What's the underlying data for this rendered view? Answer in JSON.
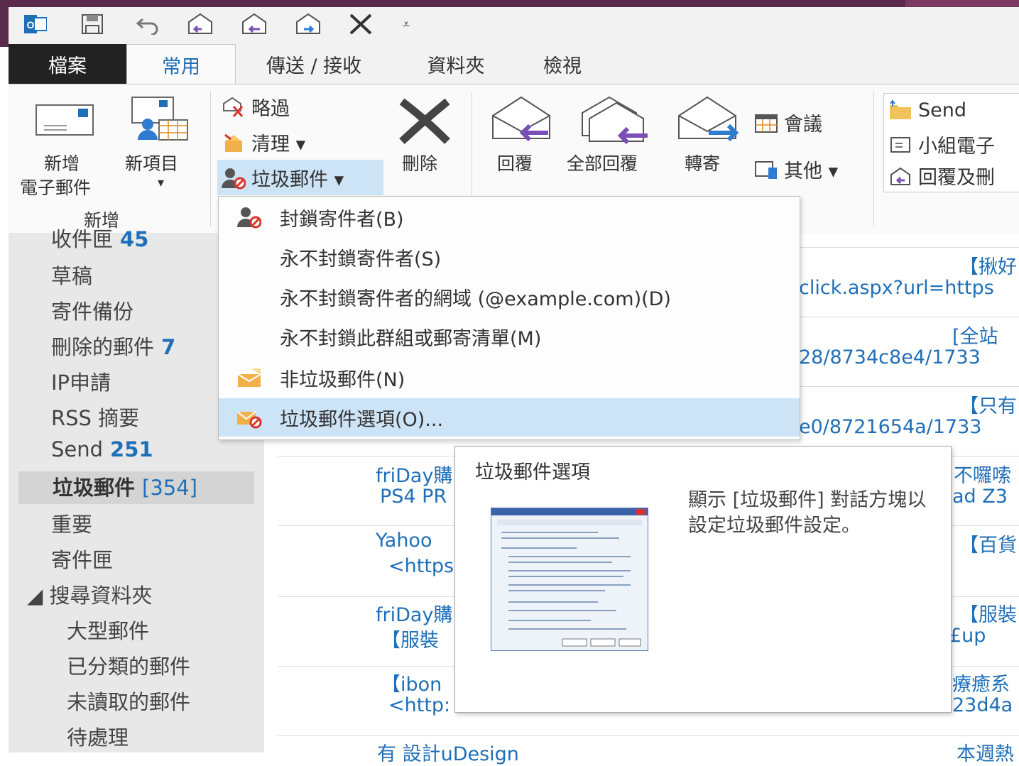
{
  "titlebar": {
    "qat_icons": [
      "outlook-icon",
      "save-icon",
      "undo-icon",
      "reply-icon",
      "reply-all-icon",
      "forward-icon",
      "delete-icon",
      "customize-icon"
    ]
  },
  "tabs": [
    {
      "label": "檔案"
    },
    {
      "label": "常用"
    },
    {
      "label": "傳送 / 接收"
    },
    {
      "label": "資料夾"
    },
    {
      "label": "檢視"
    }
  ],
  "ribbon": {
    "new_email": {
      "line1": "新增",
      "line2": "電子郵件"
    },
    "new_items": {
      "label": "新項目",
      "arrow": "▾"
    },
    "group_new": "新增",
    "ignore": "略過",
    "cleanup": "清理 ▾",
    "junk": "垃圾郵件 ▾",
    "delete": "刪除",
    "reply": "回覆",
    "reply_all": "全部回覆",
    "forward": "轉寄",
    "meeting": "會議",
    "more": "其他 ▾",
    "quicksteps": [
      "Send",
      "小組電子",
      "回覆及刪"
    ]
  },
  "folders": [
    {
      "name": "收件匣",
      "count": "45"
    },
    {
      "name": "草稿",
      "count": ""
    },
    {
      "name": "寄件備份",
      "count": ""
    },
    {
      "name": "刪除的郵件",
      "count": "7"
    },
    {
      "name": "IP申請",
      "count": ""
    },
    {
      "name": "RSS 摘要",
      "count": ""
    },
    {
      "name": "Send",
      "count": "251"
    },
    {
      "name": "垃圾郵件",
      "count": "[354]"
    },
    {
      "name": "重要",
      "count": ""
    },
    {
      "name": "寄件匣",
      "count": ""
    },
    {
      "name": "◢ 搜尋資料夾",
      "count": ""
    },
    {
      "name": "大型郵件",
      "count": ""
    },
    {
      "name": "已分類的郵件",
      "count": ""
    },
    {
      "name": "未讀取的郵件",
      "count": ""
    },
    {
      "name": "待處理",
      "count": ""
    }
  ],
  "messages": {
    "right": [
      "【揪好",
      "click.aspx?url=https",
      "[全站",
      "28/8734c8e4/1733",
      "【只有",
      "e0/8721654a/1733",
      "不囉嗦",
      "ad Z3",
      "【百貨",
      "【服裝",
      "£up",
      "療癒系",
      "23d4a",
      "本週熱"
    ],
    "left": [
      "friDay購",
      "PS4 PR",
      "Yahoo",
      "<https",
      "friDay購",
      "【服裝",
      "【ibon",
      "<http:",
      "有 設計uDesign"
    ]
  },
  "dropdown": {
    "items": [
      {
        "label": "封鎖寄件者(B)",
        "icon": "block-sender-icon"
      },
      {
        "label": "永不封鎖寄件者(S)",
        "icon": ""
      },
      {
        "label": "永不封鎖寄件者的網域 (@example.com)(D)",
        "icon": ""
      },
      {
        "label": "永不封鎖此群組或郵寄清單(M)",
        "icon": ""
      },
      {
        "label": "非垃圾郵件(N)",
        "icon": "not-junk-icon"
      },
      {
        "label": "垃圾郵件選項(O)...",
        "icon": "junk-options-icon"
      }
    ]
  },
  "tooltip": {
    "title": "垃圾郵件選項",
    "description": "顯示 [垃圾郵件] 對話方塊以設定垃圾郵件設定。"
  }
}
